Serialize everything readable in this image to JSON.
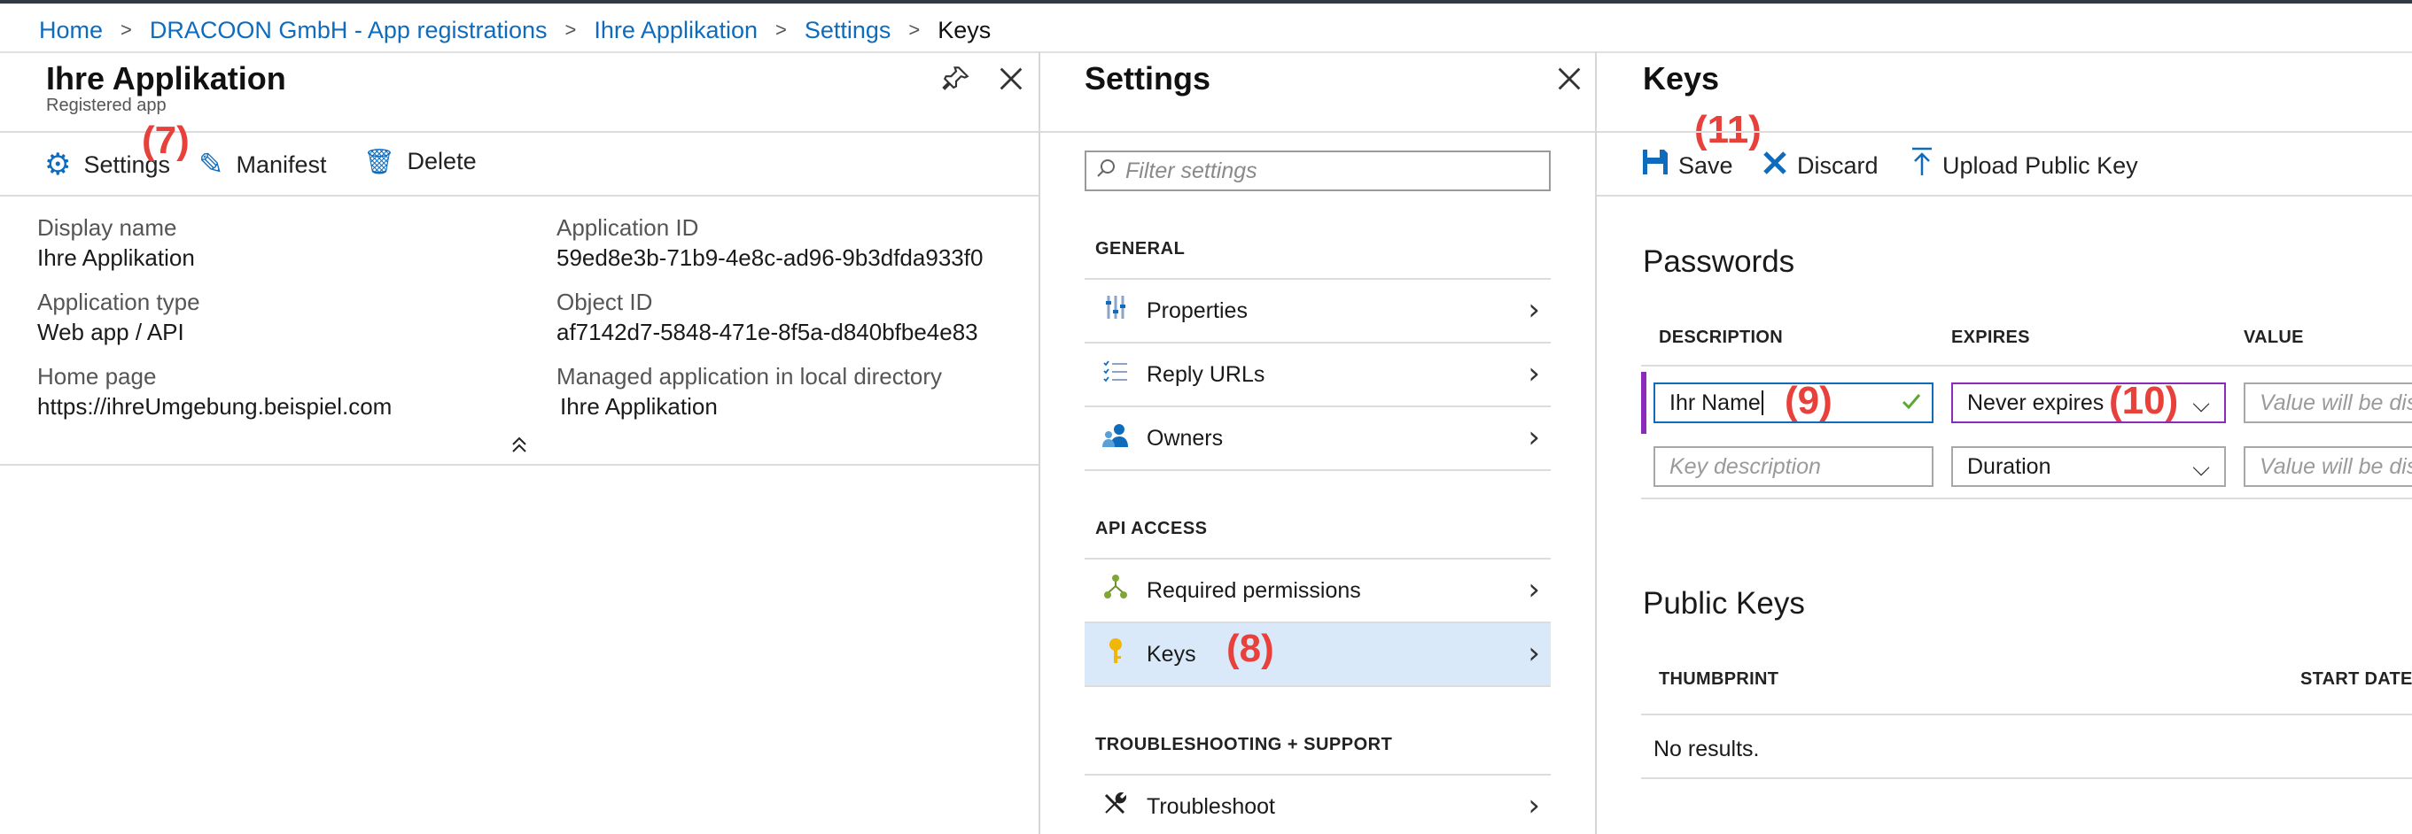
{
  "breadcrumb": {
    "items": [
      "Home",
      "DRACOON GmbH - App registrations",
      "Ihre Applikation",
      "Settings"
    ],
    "current": "Keys",
    "separator": ">"
  },
  "app_panel": {
    "title": "Ihre Applikation",
    "subtitle": "Registered app",
    "toolbar": {
      "settings_label": "Settings",
      "manifest_label": "Manifest",
      "delete_label": "Delete"
    },
    "annotation": "(7)",
    "properties": {
      "display_name_label": "Display name",
      "display_name_value": "Ihre Applikation",
      "application_type_label": "Application type",
      "application_type_value": "Web app / API",
      "home_page_label": "Home page",
      "home_page_value": "https://ihreUmgebung.beispiel.com",
      "application_id_label": "Application ID",
      "application_id_value": "59ed8e3b-71b9-4e8c-ad96-9b3dfda933f0",
      "object_id_label": "Object ID",
      "object_id_value": "af7142d7-5848-471e-8f5a-d840bfbe4e83",
      "managed_app_label": "Managed application in local directory",
      "managed_app_value": "Ihre Applikation"
    }
  },
  "settings_panel": {
    "title": "Settings",
    "filter_placeholder": "Filter settings",
    "sections": {
      "general": "GENERAL",
      "api_access": "API ACCESS",
      "troubleshooting": "TROUBLESHOOTING + SUPPORT"
    },
    "items": {
      "properties": "Properties",
      "reply_urls": "Reply URLs",
      "owners": "Owners",
      "required_permissions": "Required permissions",
      "keys": "Keys",
      "troubleshoot": "Troubleshoot"
    },
    "annotation": "(8)"
  },
  "keys_panel": {
    "title": "Keys",
    "toolbar": {
      "save_label": "Save",
      "discard_label": "Discard",
      "upload_label": "Upload Public Key"
    },
    "annotation_save": "(11)",
    "passwords": {
      "heading": "Passwords",
      "columns": [
        "DESCRIPTION",
        "EXPIRES",
        "VALUE"
      ],
      "row1": {
        "description": "Ihr Name",
        "expires": "Never expires",
        "value_placeholder": "Value will be displayed on save"
      },
      "row2": {
        "description_placeholder": "Key description",
        "expires": "Duration",
        "value_placeholder": "Value will be displayed on save"
      },
      "annotation_name": "(9)",
      "annotation_expires": "(10)"
    },
    "public_keys": {
      "heading": "Public Keys",
      "columns": [
        "THUMBPRINT",
        "START DATE"
      ],
      "empty_text": "No results."
    }
  },
  "colors": {
    "accent": "#0f6cbd",
    "annotation": "#e8403a",
    "selected_row": "#d9e9f9",
    "focus_purple": "#8b2bb9"
  }
}
